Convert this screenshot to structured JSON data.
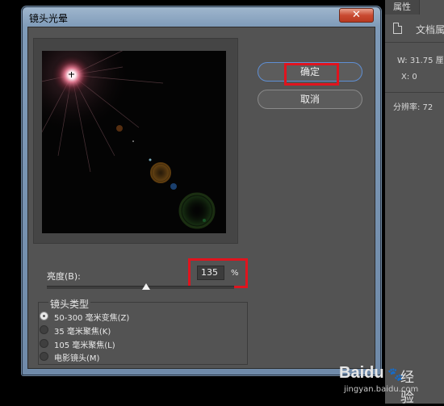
{
  "dialog": {
    "title": "镜头光晕",
    "close_glyph": "✕",
    "ok_label": "确定",
    "cancel_label": "取消",
    "brightness": {
      "label": "亮度(B):",
      "value": "135",
      "unit": "%",
      "slider_fraction": 0.55
    },
    "lens_type": {
      "title": "镜头类型",
      "options": [
        {
          "label": "50-300 毫米变焦(Z)",
          "checked": true
        },
        {
          "label": "35 毫米聚焦(K)",
          "checked": false
        },
        {
          "label": "105 毫米聚焦(L)",
          "checked": false
        },
        {
          "label": "电影镜头(M)",
          "checked": false
        }
      ]
    },
    "highlight_color": "#e0141e"
  },
  "properties_panel": {
    "tab": "属性",
    "doc_label": "文档属",
    "width_label": "W:",
    "width_value": "31.75 厘",
    "x_label": "X:",
    "x_value": "0",
    "resolution_label": "分辨率: 72"
  },
  "watermark": {
    "logo": "Baidu",
    "suffix": "经验",
    "url": "jingyan.baidu.com"
  }
}
